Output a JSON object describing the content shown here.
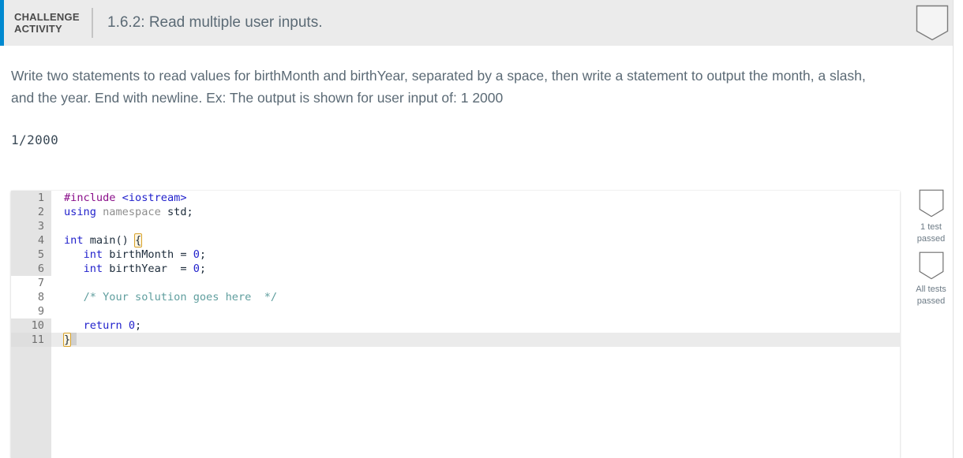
{
  "header": {
    "kicker_line1": "CHALLENGE",
    "kicker_line2": "ACTIVITY",
    "title": "1.6.2: Read multiple user inputs.",
    "badge_icon": "shield-banner-icon",
    "accent_color": "#0089d0",
    "background_color": "#ebebeb"
  },
  "instructions": {
    "text": "Write two statements to read values for birthMonth and birthYear, separated by a space, then write a statement to output the month, a slash, and the year. End with newline. Ex: The output is shown for user input of: 1 2000",
    "example_output": "1/2000"
  },
  "editor": {
    "language": "cpp",
    "active_line": 11,
    "editable_lines": [
      7,
      8,
      9
    ],
    "lines": [
      {
        "num": "1",
        "text": "#include <iostream>"
      },
      {
        "num": "2",
        "text": "using namespace std;"
      },
      {
        "num": "3",
        "text": ""
      },
      {
        "num": "4",
        "text": "int main() {"
      },
      {
        "num": "5",
        "text": "   int birthMonth = 0;"
      },
      {
        "num": "6",
        "text": "   int birthYear  = 0;"
      },
      {
        "num": "7",
        "text": ""
      },
      {
        "num": "8",
        "text": "   /* Your solution goes here  */"
      },
      {
        "num": "9",
        "text": ""
      },
      {
        "num": "10",
        "text": "   return 0;"
      },
      {
        "num": "11",
        "text": "}"
      }
    ]
  },
  "test_panel": {
    "items": [
      {
        "icon": "shield-banner-icon",
        "label_line1": "1 test",
        "label_line2": "passed"
      },
      {
        "icon": "shield-banner-icon",
        "label_line1": "All tests",
        "label_line2": "passed"
      }
    ]
  }
}
